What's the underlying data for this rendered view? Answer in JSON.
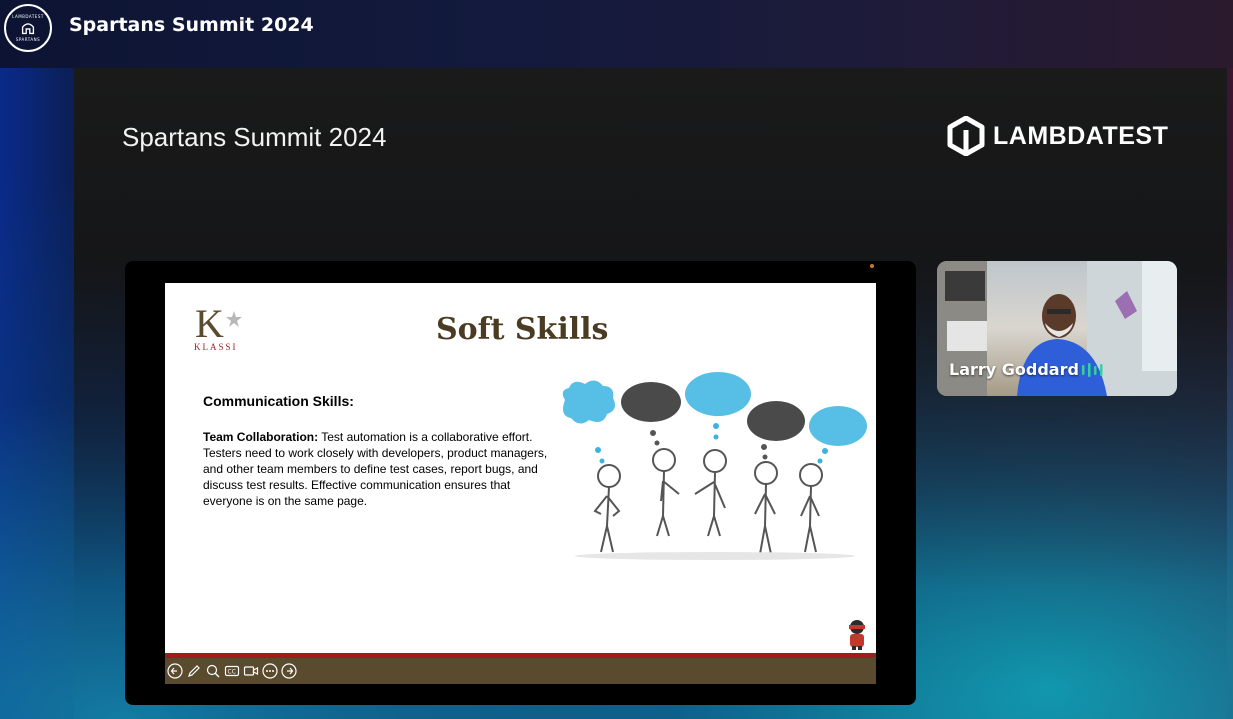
{
  "header": {
    "logo_top": "LAMBDATEST",
    "logo_bottom": "SPARTANS",
    "title": "Spartans Summit 2024"
  },
  "stage": {
    "title": "Spartans Summit 2024",
    "brand": "LAMBDATEST"
  },
  "slide": {
    "logo_text": "KLASSI",
    "title": "Soft Skills",
    "subheading": "Communication Skills:",
    "body_lead": "Team Collaboration:",
    "body_text": " Test automation is a collaborative effort. Testers need to work closely with developers, product managers, and other team members to define test cases, report bugs, and discuss test results. Effective communication ensures that everyone is on the same page."
  },
  "toolbar": {
    "tools": [
      "prev-icon",
      "pen-icon",
      "zoom-icon",
      "captions-icon",
      "camera-icon",
      "more-icon",
      "next-icon"
    ]
  },
  "speaker": {
    "name": "Larry Goddard"
  },
  "colors": {
    "slide_title": "#4a3b22",
    "toolbar": "#5a4a2e",
    "redline": "#a11d1d",
    "audio": "#33d1a1"
  }
}
